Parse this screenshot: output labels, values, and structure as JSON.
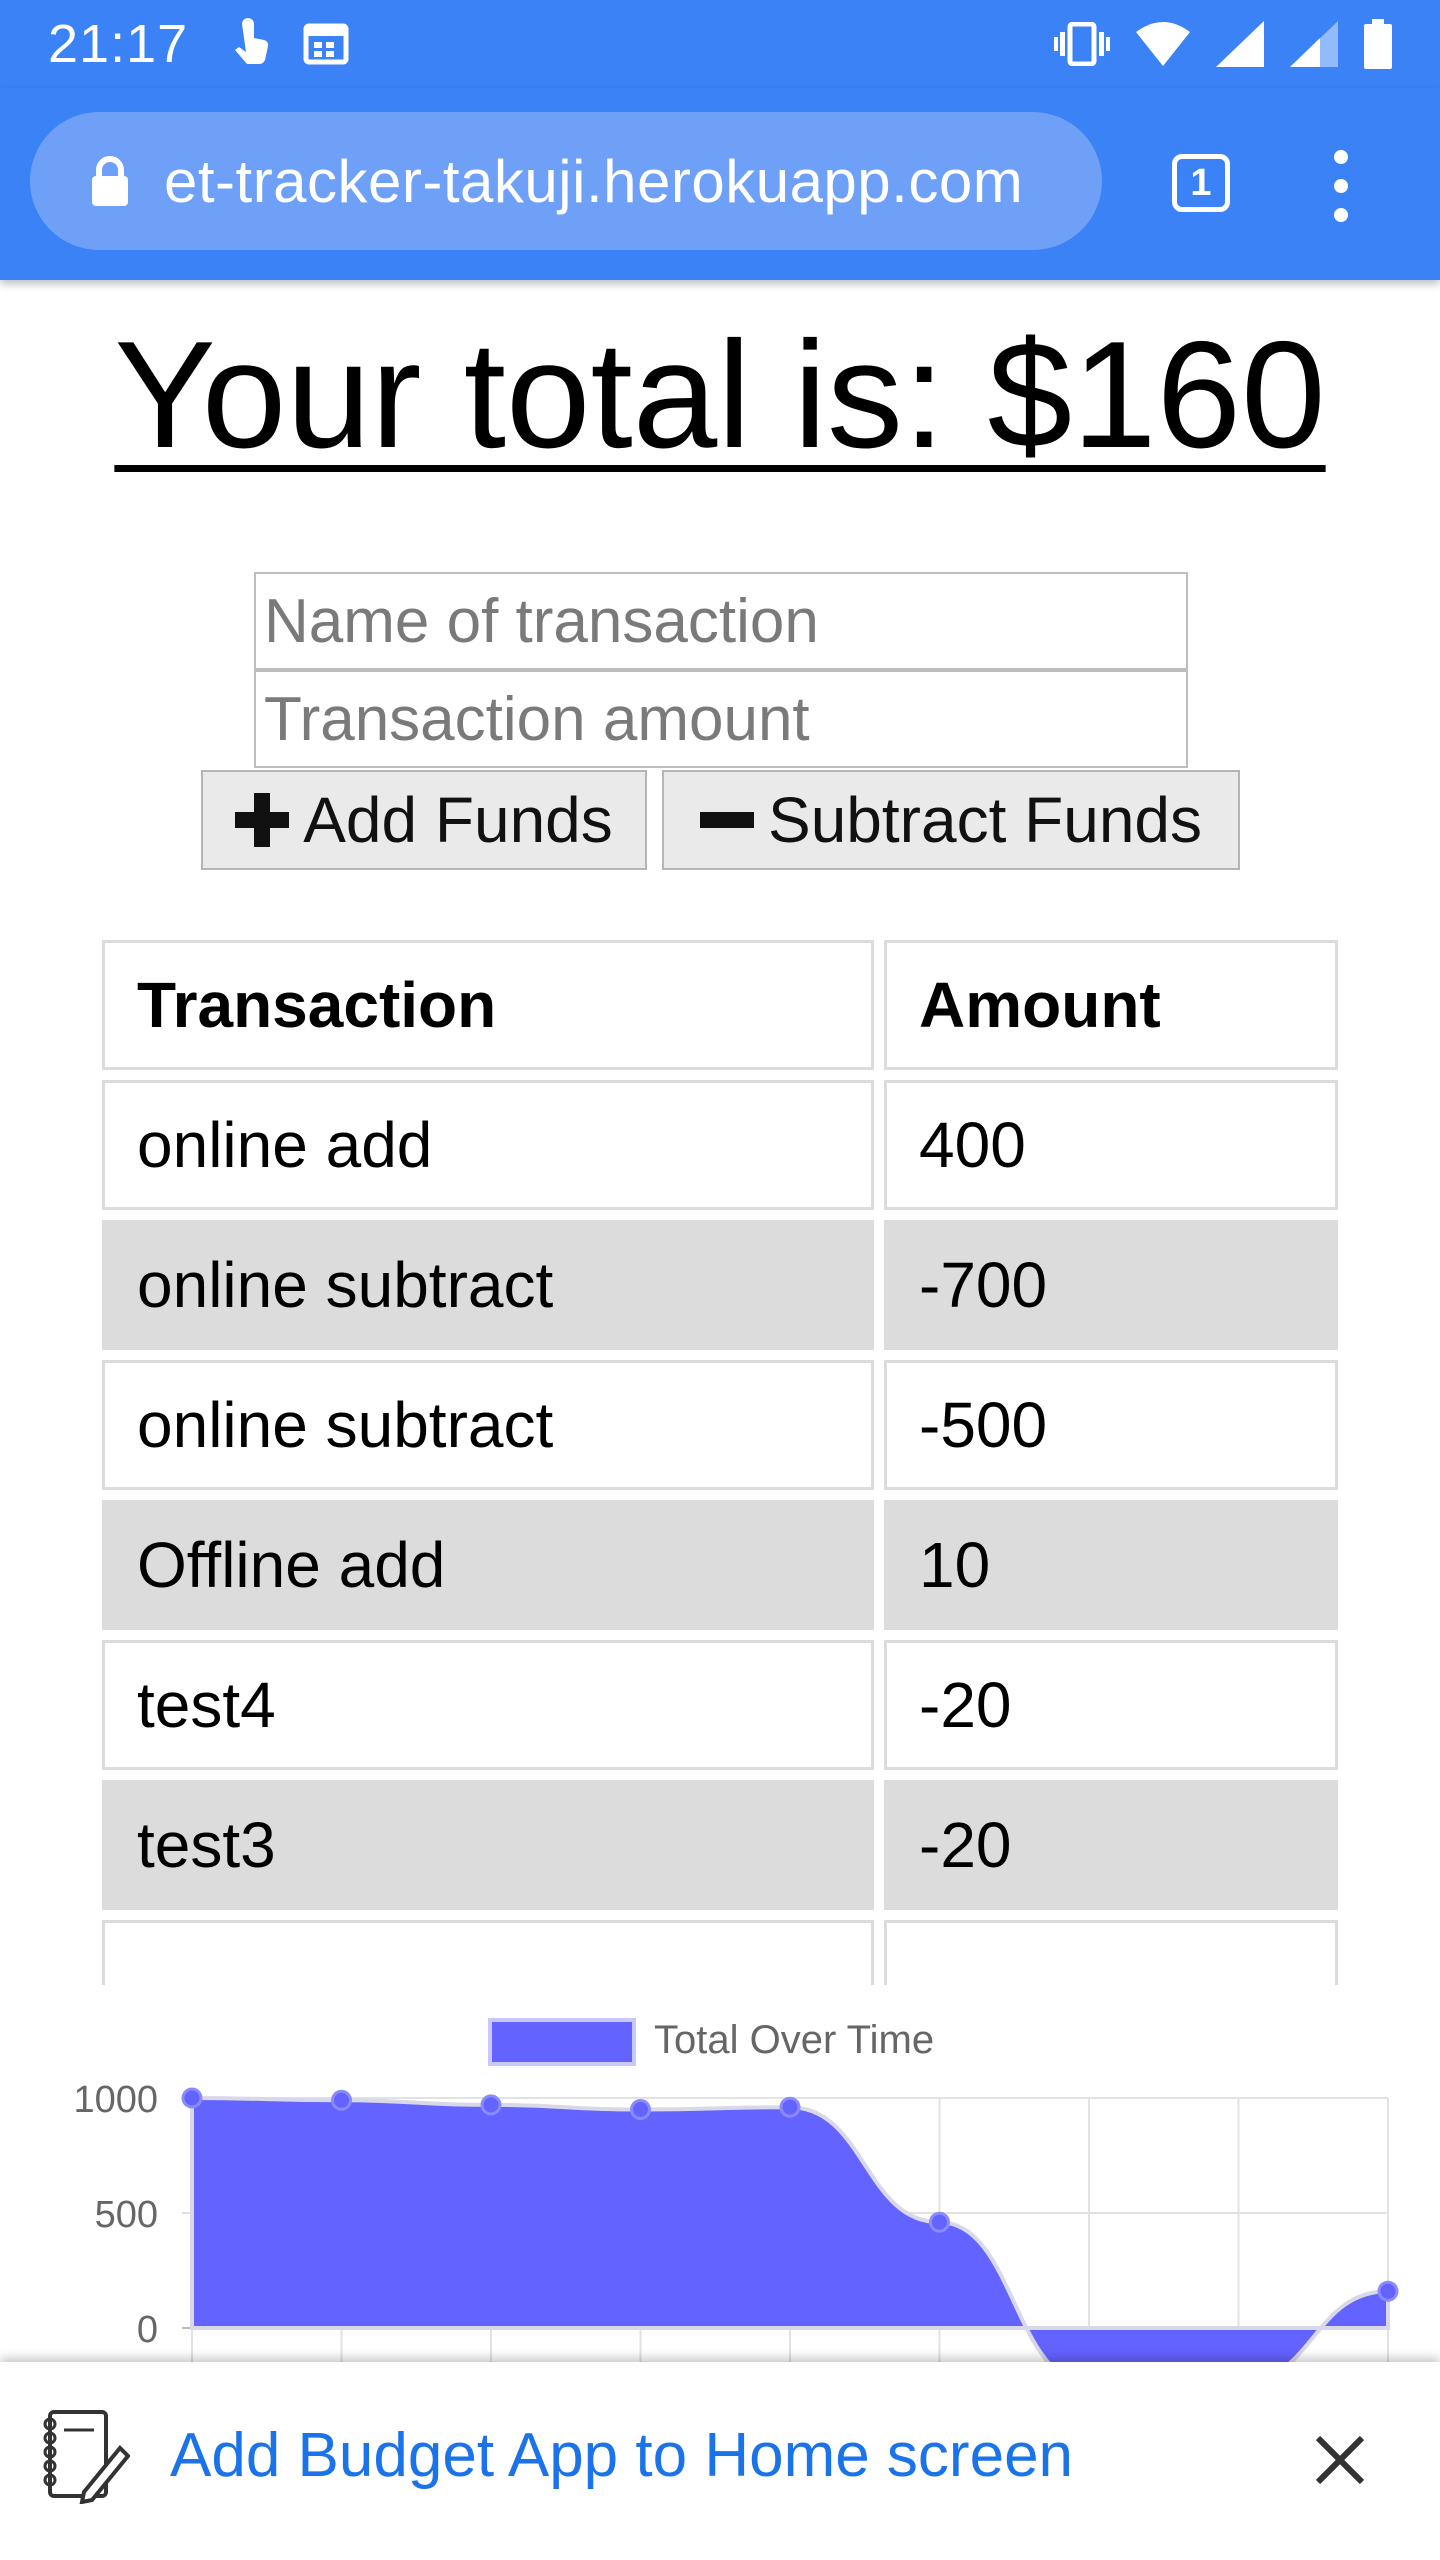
{
  "status_bar": {
    "time": "21:17",
    "icons": [
      "touch-icon",
      "calendar-icon",
      "vibrate-icon",
      "wifi-icon",
      "signal-icon",
      "signal-2-icon",
      "battery-icon"
    ]
  },
  "browser": {
    "url": "et-tracker-takuji.herokuapp.com",
    "tab_count": "1"
  },
  "page": {
    "total_label": "Your total is: $160"
  },
  "form": {
    "name_placeholder": "Name of transaction",
    "amount_placeholder": "Transaction amount",
    "add_label": "Add Funds",
    "subtract_label": "Subtract Funds"
  },
  "table": {
    "headers": [
      "Transaction",
      "Amount"
    ],
    "rows": [
      [
        "online add",
        "400"
      ],
      [
        "online subtract",
        "-700"
      ],
      [
        "online subtract",
        "-500"
      ],
      [
        "Offline add",
        "10"
      ],
      [
        "test4",
        "-20"
      ],
      [
        "test3",
        "-20"
      ]
    ]
  },
  "chart_data": {
    "type": "area",
    "legend": [
      "Total Over Time"
    ],
    "y_ticks": [
      "1000",
      "500",
      "0"
    ],
    "ylim": [
      -200,
      1000
    ],
    "series": [
      {
        "name": "Total Over Time",
        "color": "#6363ff",
        "values": [
          1000,
          990,
          970,
          950,
          960,
          460,
          -240,
          -240,
          160
        ]
      }
    ],
    "grid": true
  },
  "banner": {
    "text": "Add Budget App to Home screen"
  }
}
